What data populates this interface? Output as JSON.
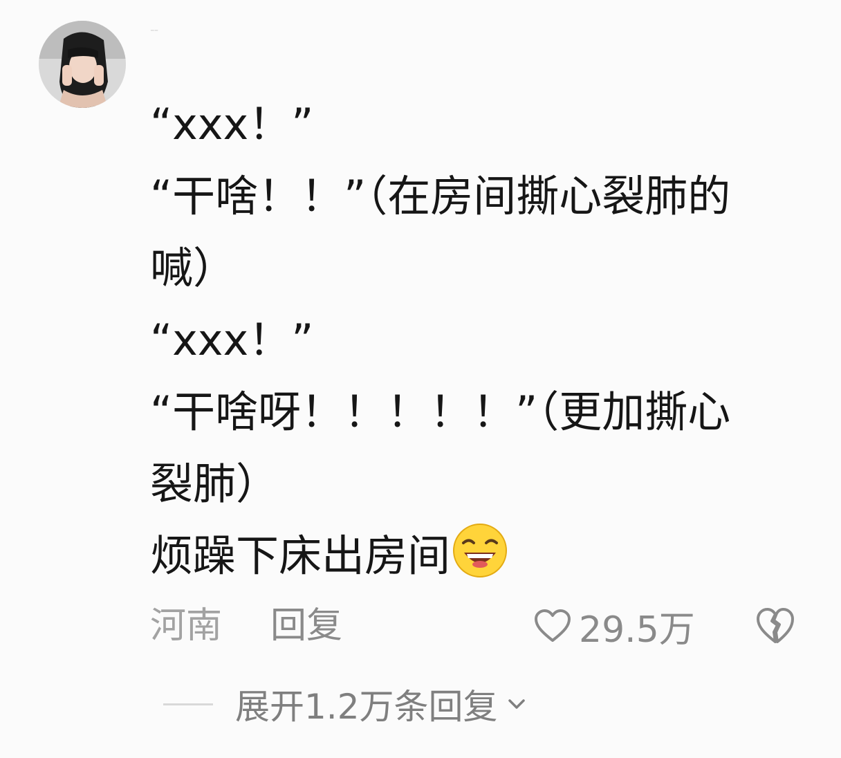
{
  "comment": {
    "lines": [
      "“xxx！”",
      "“干啥！！”（在房间撕心裂肺的",
      "喊）",
      "“xxx！”",
      "“干啥呀！！！！！”（更加撕心",
      "裂肺）",
      "烦躁下床出房间"
    ],
    "emoji": "grinning-squinting-face-icon"
  },
  "meta": {
    "location": "河南",
    "reply_label": "回复",
    "like_count": "29.5万"
  },
  "expand": {
    "label": "展开1.2万条回复"
  },
  "colors": {
    "background": "#fbfbfb",
    "text": "#161616",
    "meta_text": "#8a8a8a",
    "emoji_yellow": "#ffd43a"
  }
}
